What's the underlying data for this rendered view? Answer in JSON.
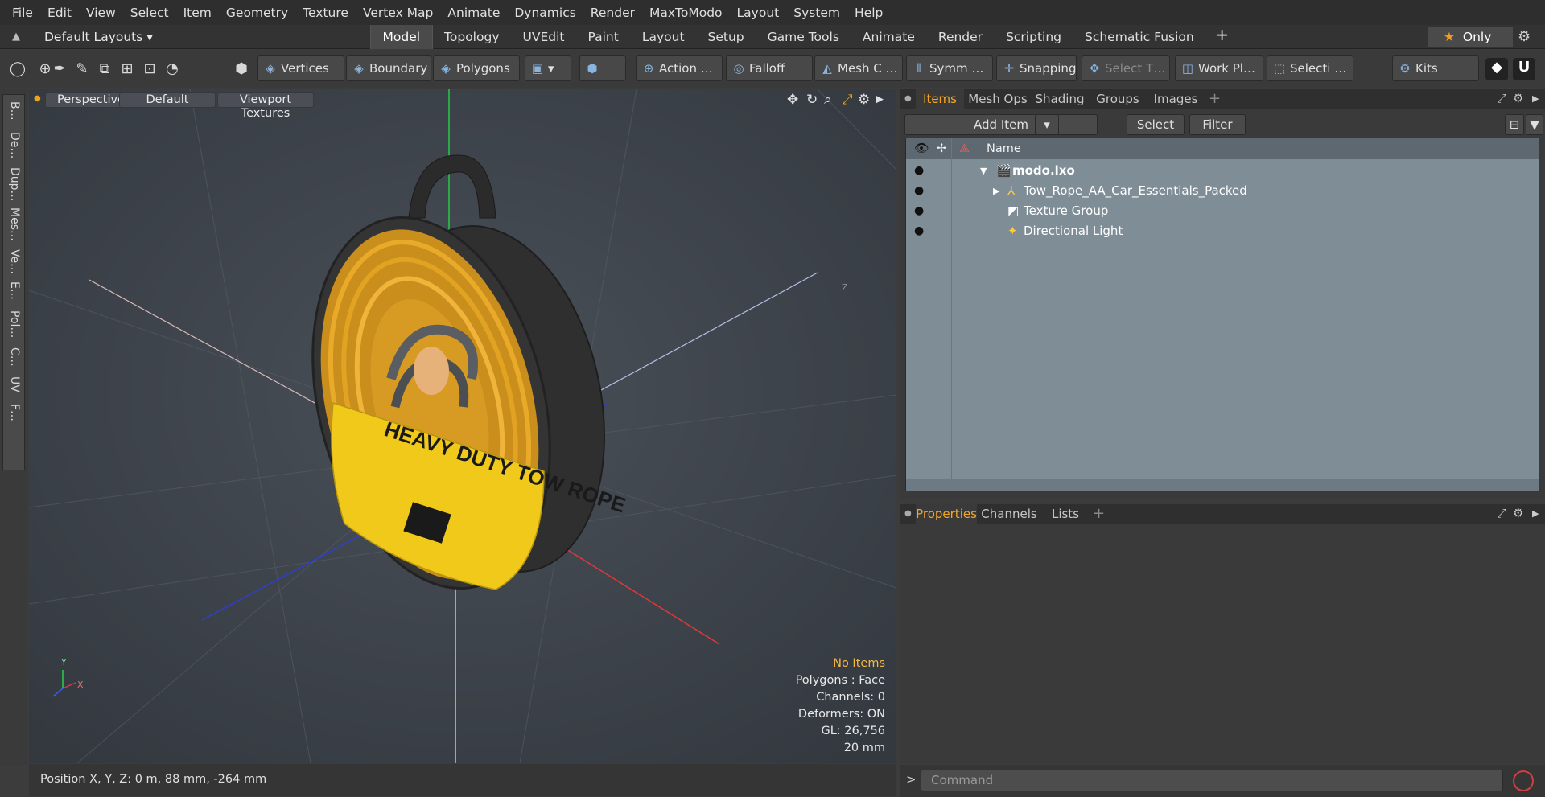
{
  "menubar": [
    "File",
    "Edit",
    "View",
    "Select",
    "Item",
    "Geometry",
    "Texture",
    "Vertex Map",
    "Animate",
    "Dynamics",
    "Render",
    "MaxToModo",
    "Layout",
    "System",
    "Help"
  ],
  "layouts": {
    "label": "Default Layouts ▾"
  },
  "tabs": [
    "Model",
    "Topology",
    "UVEdit",
    "Paint",
    "Layout",
    "Setup",
    "Game Tools",
    "Animate",
    "Render",
    "Scripting",
    "Schematic Fusion"
  ],
  "only_label": "Only",
  "toolbar": {
    "vertices": "Vertices",
    "boundary": "Boundary",
    "polygons": "Polygons",
    "action": "Action",
    "action_more": "…",
    "falloff": "Falloff",
    "mesh": "Mesh C …",
    "symm": "Symm …",
    "snapping": "Snapping",
    "select_t": "Select T…",
    "workpl": "Work Pl…",
    "selecti": "Selecti …",
    "kits": "Kits"
  },
  "left_tabs": [
    "B…",
    "De…",
    "Dup…",
    "Mes…",
    "Ve…",
    "E…",
    "Pol…",
    "C…",
    "UV",
    "F…"
  ],
  "viewport": {
    "perspective": "Perspective",
    "default": "Default",
    "textures": "Viewport Textures",
    "info": {
      "no_items": "No Items",
      "polygons": "Polygons : Face",
      "channels": "Channels: 0",
      "deformers": "Deformers: ON",
      "gl": "GL: 26,756",
      "scale": "20 mm"
    },
    "axis_y": "Y",
    "axis_x": "X",
    "axis_z": "Z",
    "label_text": "HEAVY DUTY TOW ROPE"
  },
  "status": {
    "position": "Position X, Y, Z:   0 m, 88 mm, -264 mm"
  },
  "items_panel": {
    "tabs": [
      "Items",
      "Mesh Ops",
      "Shading",
      "Groups",
      "Images"
    ],
    "add_item": "Add Item",
    "select": "Select",
    "filter": "Filter",
    "col_name": "Name",
    "rows": [
      {
        "label": "modo.lxo",
        "bold": true
      },
      {
        "label": "Tow_Rope_AA_Car_Essentials_Packed"
      },
      {
        "label": "Texture Group"
      },
      {
        "label": "Directional Light"
      }
    ]
  },
  "props_panel": {
    "tabs": [
      "Properties",
      "Channels",
      "Lists"
    ]
  },
  "command": {
    "placeholder": "Command",
    "prompt": ">"
  },
  "colors": {
    "accent": "#f5a623",
    "viewport_bg": "#3b4047",
    "tree_bg": "#7f8d96"
  }
}
